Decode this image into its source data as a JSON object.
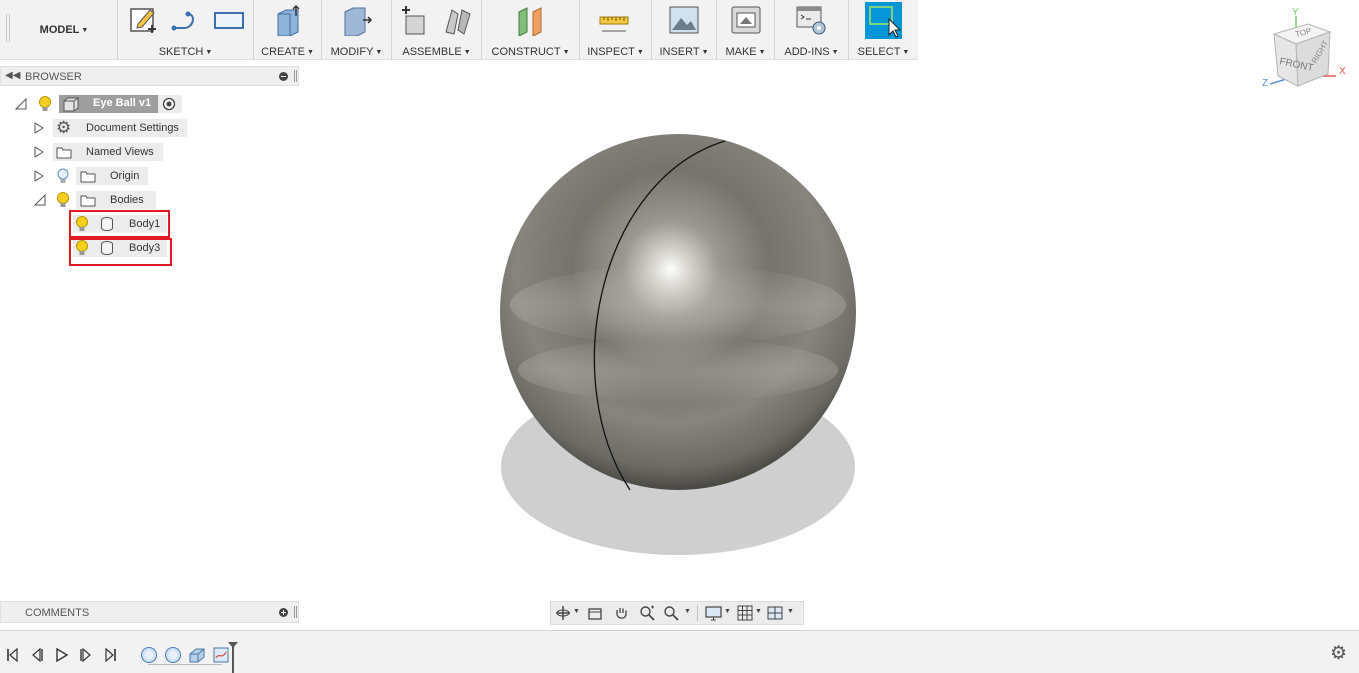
{
  "workspace": {
    "label": "MODEL"
  },
  "toolbar": {
    "groups": [
      {
        "label": "SKETCH"
      },
      {
        "label": "CREATE"
      },
      {
        "label": "MODIFY"
      },
      {
        "label": "ASSEMBLE"
      },
      {
        "label": "CONSTRUCT"
      },
      {
        "label": "INSPECT"
      },
      {
        "label": "INSERT"
      },
      {
        "label": "MAKE"
      },
      {
        "label": "ADD-INS"
      },
      {
        "label": "SELECT"
      }
    ]
  },
  "browser": {
    "title": "BROWSER",
    "items": [
      {
        "label": "Eye Ball v1"
      },
      {
        "label": "Document Settings"
      },
      {
        "label": "Named Views"
      },
      {
        "label": "Origin"
      },
      {
        "label": "Bodies"
      },
      {
        "label": "Body1"
      },
      {
        "label": "Body3"
      }
    ]
  },
  "comments": {
    "title": "COMMENTS"
  },
  "viewcube": {
    "top": "TOP",
    "front": "FRONT",
    "right": "RIGHT",
    "axis_x": "X",
    "axis_y": "Y",
    "axis_z": "Z"
  },
  "colors": {
    "selection_highlight": "#e01b24",
    "select_tool_active": "#0696d7",
    "axis_x": "#e8554e",
    "axis_y": "#7cc36f",
    "axis_z": "#5b8fd6"
  }
}
